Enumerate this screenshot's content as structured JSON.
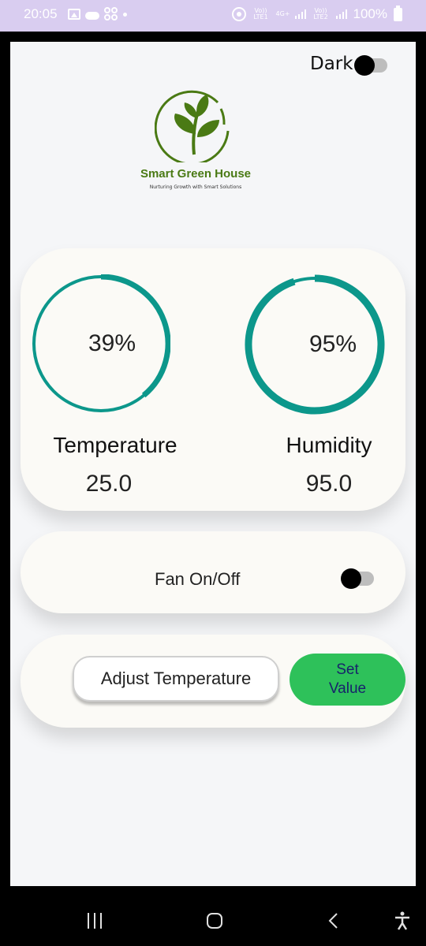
{
  "status_bar": {
    "time": "20:05",
    "battery": "100%",
    "network_1": "Vo)) LTE1",
    "network_2": "4G+",
    "network_3": "Vo)) LTE2",
    "icons": [
      "gallery-icon",
      "cloud-icon",
      "apps-icon",
      "dot-icon",
      "hotspot-icon",
      "signal-icon",
      "battery-icon"
    ]
  },
  "header": {
    "dark_label": "Dark",
    "dark_mode_on": false
  },
  "logo": {
    "title": "Smart Green House",
    "subtitle": "Nurturing Growth with Smart Solutions",
    "icon": "plant-icon",
    "color": "#4a7a14"
  },
  "gauges": [
    {
      "label": "Temperature",
      "percent_text": "39%",
      "value": "25.0",
      "fraction": 0.39
    },
    {
      "label": "Humidity",
      "percent_text": "95%",
      "value": "95.0",
      "fraction": 0.95
    }
  ],
  "fan": {
    "label": "Fan On/Off",
    "on": false
  },
  "adjust": {
    "input_text": "Adjust Temperature",
    "set_label": "Set\nValue"
  },
  "nav": {
    "icons": [
      "recents-icon",
      "home-icon",
      "back-icon",
      "accessibility-icon"
    ]
  },
  "colors": {
    "accent_teal": "#0c978b",
    "set_button": "#2ec15a",
    "set_text": "#17236b",
    "card": "#fbfaf6",
    "status_bar": "#d9cdf0"
  }
}
